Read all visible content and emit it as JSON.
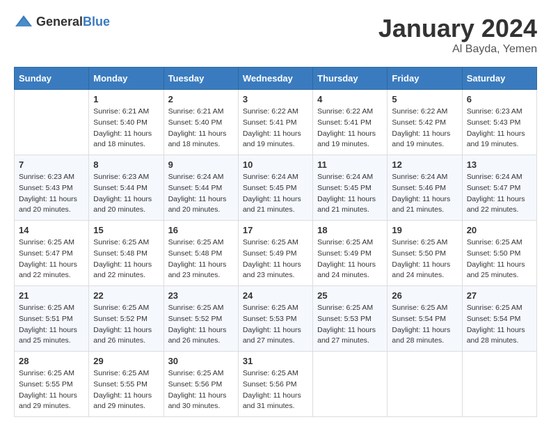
{
  "logo": {
    "text_general": "General",
    "text_blue": "Blue"
  },
  "header": {
    "month_year": "January 2024",
    "location": "Al Bayda, Yemen"
  },
  "days_of_week": [
    "Sunday",
    "Monday",
    "Tuesday",
    "Wednesday",
    "Thursday",
    "Friday",
    "Saturday"
  ],
  "weeks": [
    [
      {
        "day": "",
        "sunrise": "",
        "sunset": "",
        "daylight": ""
      },
      {
        "day": "1",
        "sunrise": "Sunrise: 6:21 AM",
        "sunset": "Sunset: 5:40 PM",
        "daylight": "Daylight: 11 hours and 18 minutes."
      },
      {
        "day": "2",
        "sunrise": "Sunrise: 6:21 AM",
        "sunset": "Sunset: 5:40 PM",
        "daylight": "Daylight: 11 hours and 18 minutes."
      },
      {
        "day": "3",
        "sunrise": "Sunrise: 6:22 AM",
        "sunset": "Sunset: 5:41 PM",
        "daylight": "Daylight: 11 hours and 19 minutes."
      },
      {
        "day": "4",
        "sunrise": "Sunrise: 6:22 AM",
        "sunset": "Sunset: 5:41 PM",
        "daylight": "Daylight: 11 hours and 19 minutes."
      },
      {
        "day": "5",
        "sunrise": "Sunrise: 6:22 AM",
        "sunset": "Sunset: 5:42 PM",
        "daylight": "Daylight: 11 hours and 19 minutes."
      },
      {
        "day": "6",
        "sunrise": "Sunrise: 6:23 AM",
        "sunset": "Sunset: 5:43 PM",
        "daylight": "Daylight: 11 hours and 19 minutes."
      }
    ],
    [
      {
        "day": "7",
        "sunrise": "Sunrise: 6:23 AM",
        "sunset": "Sunset: 5:43 PM",
        "daylight": "Daylight: 11 hours and 20 minutes."
      },
      {
        "day": "8",
        "sunrise": "Sunrise: 6:23 AM",
        "sunset": "Sunset: 5:44 PM",
        "daylight": "Daylight: 11 hours and 20 minutes."
      },
      {
        "day": "9",
        "sunrise": "Sunrise: 6:24 AM",
        "sunset": "Sunset: 5:44 PM",
        "daylight": "Daylight: 11 hours and 20 minutes."
      },
      {
        "day": "10",
        "sunrise": "Sunrise: 6:24 AM",
        "sunset": "Sunset: 5:45 PM",
        "daylight": "Daylight: 11 hours and 21 minutes."
      },
      {
        "day": "11",
        "sunrise": "Sunrise: 6:24 AM",
        "sunset": "Sunset: 5:45 PM",
        "daylight": "Daylight: 11 hours and 21 minutes."
      },
      {
        "day": "12",
        "sunrise": "Sunrise: 6:24 AM",
        "sunset": "Sunset: 5:46 PM",
        "daylight": "Daylight: 11 hours and 21 minutes."
      },
      {
        "day": "13",
        "sunrise": "Sunrise: 6:24 AM",
        "sunset": "Sunset: 5:47 PM",
        "daylight": "Daylight: 11 hours and 22 minutes."
      }
    ],
    [
      {
        "day": "14",
        "sunrise": "Sunrise: 6:25 AM",
        "sunset": "Sunset: 5:47 PM",
        "daylight": "Daylight: 11 hours and 22 minutes."
      },
      {
        "day": "15",
        "sunrise": "Sunrise: 6:25 AM",
        "sunset": "Sunset: 5:48 PM",
        "daylight": "Daylight: 11 hours and 22 minutes."
      },
      {
        "day": "16",
        "sunrise": "Sunrise: 6:25 AM",
        "sunset": "Sunset: 5:48 PM",
        "daylight": "Daylight: 11 hours and 23 minutes."
      },
      {
        "day": "17",
        "sunrise": "Sunrise: 6:25 AM",
        "sunset": "Sunset: 5:49 PM",
        "daylight": "Daylight: 11 hours and 23 minutes."
      },
      {
        "day": "18",
        "sunrise": "Sunrise: 6:25 AM",
        "sunset": "Sunset: 5:49 PM",
        "daylight": "Daylight: 11 hours and 24 minutes."
      },
      {
        "day": "19",
        "sunrise": "Sunrise: 6:25 AM",
        "sunset": "Sunset: 5:50 PM",
        "daylight": "Daylight: 11 hours and 24 minutes."
      },
      {
        "day": "20",
        "sunrise": "Sunrise: 6:25 AM",
        "sunset": "Sunset: 5:50 PM",
        "daylight": "Daylight: 11 hours and 25 minutes."
      }
    ],
    [
      {
        "day": "21",
        "sunrise": "Sunrise: 6:25 AM",
        "sunset": "Sunset: 5:51 PM",
        "daylight": "Daylight: 11 hours and 25 minutes."
      },
      {
        "day": "22",
        "sunrise": "Sunrise: 6:25 AM",
        "sunset": "Sunset: 5:52 PM",
        "daylight": "Daylight: 11 hours and 26 minutes."
      },
      {
        "day": "23",
        "sunrise": "Sunrise: 6:25 AM",
        "sunset": "Sunset: 5:52 PM",
        "daylight": "Daylight: 11 hours and 26 minutes."
      },
      {
        "day": "24",
        "sunrise": "Sunrise: 6:25 AM",
        "sunset": "Sunset: 5:53 PM",
        "daylight": "Daylight: 11 hours and 27 minutes."
      },
      {
        "day": "25",
        "sunrise": "Sunrise: 6:25 AM",
        "sunset": "Sunset: 5:53 PM",
        "daylight": "Daylight: 11 hours and 27 minutes."
      },
      {
        "day": "26",
        "sunrise": "Sunrise: 6:25 AM",
        "sunset": "Sunset: 5:54 PM",
        "daylight": "Daylight: 11 hours and 28 minutes."
      },
      {
        "day": "27",
        "sunrise": "Sunrise: 6:25 AM",
        "sunset": "Sunset: 5:54 PM",
        "daylight": "Daylight: 11 hours and 28 minutes."
      }
    ],
    [
      {
        "day": "28",
        "sunrise": "Sunrise: 6:25 AM",
        "sunset": "Sunset: 5:55 PM",
        "daylight": "Daylight: 11 hours and 29 minutes."
      },
      {
        "day": "29",
        "sunrise": "Sunrise: 6:25 AM",
        "sunset": "Sunset: 5:55 PM",
        "daylight": "Daylight: 11 hours and 29 minutes."
      },
      {
        "day": "30",
        "sunrise": "Sunrise: 6:25 AM",
        "sunset": "Sunset: 5:56 PM",
        "daylight": "Daylight: 11 hours and 30 minutes."
      },
      {
        "day": "31",
        "sunrise": "Sunrise: 6:25 AM",
        "sunset": "Sunset: 5:56 PM",
        "daylight": "Daylight: 11 hours and 31 minutes."
      },
      {
        "day": "",
        "sunrise": "",
        "sunset": "",
        "daylight": ""
      },
      {
        "day": "",
        "sunrise": "",
        "sunset": "",
        "daylight": ""
      },
      {
        "day": "",
        "sunrise": "",
        "sunset": "",
        "daylight": ""
      }
    ]
  ]
}
